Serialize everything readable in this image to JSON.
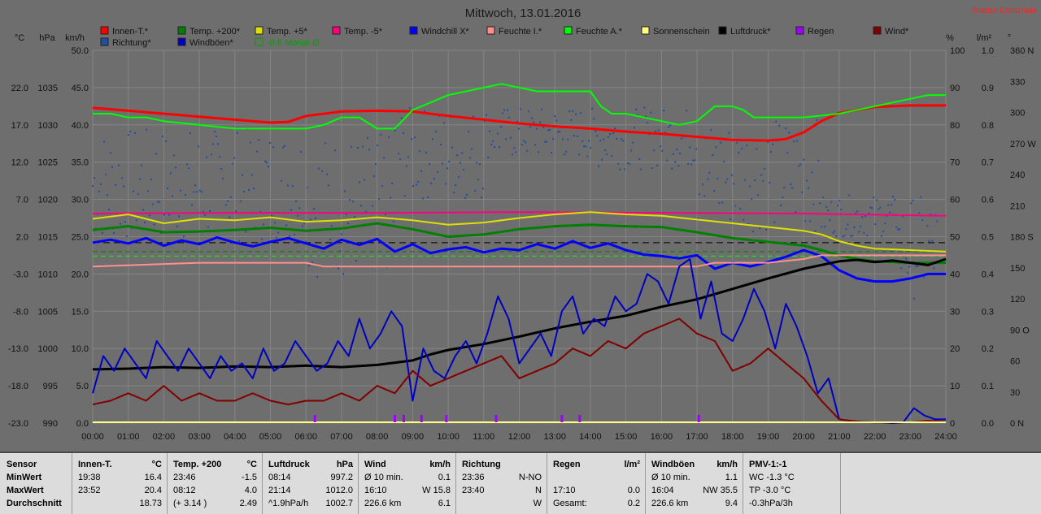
{
  "chart_data": {
    "type": "line",
    "title": "Mittwoch, 13.01.2016",
    "station": "Station Göritzhain",
    "x_ticks": [
      "00:00",
      "01:00",
      "02:00",
      "03:00",
      "04:00",
      "05:00",
      "06:00",
      "07:00",
      "08:00",
      "09:00",
      "10:00",
      "11:00",
      "12:00",
      "13:00",
      "14:00",
      "15:00",
      "16:00",
      "17:00",
      "18:00",
      "19:00",
      "20:00",
      "21:00",
      "22:00",
      "23:00",
      "24:00"
    ],
    "axes": {
      "temp": {
        "unit": "°C",
        "ticks": [
          "22.0",
          "17.0",
          "12.0",
          "7.0",
          "2.0",
          "-3.0",
          "-8.0",
          "-13.0",
          "-18.0",
          "-23.0"
        ],
        "range": [
          -23,
          27
        ]
      },
      "pressure": {
        "unit": "hPa",
        "ticks": [
          "1035",
          "1030",
          "1025",
          "1020",
          "1015",
          "1010",
          "1005",
          "1000",
          "995",
          "990"
        ],
        "range": [
          990,
          1040
        ]
      },
      "wind": {
        "unit": "km/h",
        "ticks": [
          "50.0",
          "45.0",
          "40.0",
          "35.0",
          "30.0",
          "25.0",
          "20.0",
          "15.0",
          "10.0",
          "5.0",
          "0.0"
        ],
        "range": [
          0,
          50
        ]
      },
      "humidity": {
        "unit": "%",
        "ticks": [
          "100",
          "90",
          "80",
          "70",
          "60",
          "50",
          "40",
          "30",
          "20",
          "10",
          "0"
        ],
        "range": [
          0,
          100
        ]
      },
      "rain": {
        "unit": "l/m²",
        "ticks": [
          "1.0",
          "0.9",
          "0.8",
          "0.7",
          "0.6",
          "0.5",
          "0.4",
          "0.3",
          "0.2",
          "0.1",
          "0.0"
        ],
        "range": [
          0,
          1
        ]
      },
      "direction": {
        "unit": "°",
        "ticks": [
          "360 N",
          "330",
          "300",
          "270 W",
          "240",
          "210",
          "180 S",
          "150",
          "120",
          "90 O",
          "60",
          "30",
          "0 N"
        ],
        "range": [
          0,
          360
        ]
      }
    },
    "legend": [
      {
        "name": "Innen-T.*",
        "color": "#ff0000"
      },
      {
        "name": "Temp. +200*",
        "color": "#008000"
      },
      {
        "name": "Temp. +5*",
        "color": "#e0e000"
      },
      {
        "name": "Temp. -5*",
        "color": "#ff0080"
      },
      {
        "name": "Windchill X*",
        "color": "#0000ff"
      },
      {
        "name": "Feuchte I.*",
        "color": "#ff9090"
      },
      {
        "name": "Feuchte A.*",
        "color": "#00ff00"
      },
      {
        "name": "Sonnenschein",
        "color": "#ffff80"
      },
      {
        "name": "Luftdruck*",
        "color": "#000000"
      },
      {
        "name": "Regen",
        "color": "#a000ff"
      },
      {
        "name": "Wind*",
        "color": "#800000"
      },
      {
        "name": "Richtung*",
        "color": "#1e4fa0"
      },
      {
        "name": "Windböen*",
        "color": "#0000c0"
      },
      {
        "name": "-0.6 Monat-Ø",
        "color": "#00a000"
      }
    ],
    "series": [
      {
        "name": "Innen-T.*",
        "axis": "temp",
        "color": "#ff0000",
        "width": 3,
        "x": [
          0,
          1,
          2,
          3,
          4,
          5,
          5.5,
          6,
          7,
          8,
          9,
          10,
          11,
          12,
          13,
          14,
          15,
          16,
          17,
          18,
          19,
          19.5,
          20,
          20.5,
          21,
          22,
          23,
          24
        ],
        "y": [
          19.3,
          18.9,
          18.5,
          18.1,
          17.7,
          17.3,
          17.4,
          18.2,
          18.8,
          18.9,
          18.8,
          18.2,
          17.7,
          17.2,
          16.8,
          16.5,
          16.1,
          15.8,
          15.4,
          15.0,
          14.9,
          15.1,
          16.0,
          17.5,
          18.6,
          19.4,
          19.6,
          19.6
        ]
      },
      {
        "name": "Feuchte A.*",
        "axis": "humidity",
        "color": "#00ff00",
        "width": 2,
        "x": [
          0,
          0.5,
          1,
          1.5,
          2,
          3,
          4,
          5,
          6,
          6.5,
          7,
          7.5,
          8,
          8.5,
          9,
          9.5,
          10,
          11,
          11.5,
          12,
          12.5,
          13,
          14,
          14.3,
          14.6,
          15,
          16,
          16.5,
          17,
          17.5,
          18,
          18.3,
          18.6,
          19,
          20,
          21,
          22,
          23,
          23.5,
          24
        ],
        "y": [
          83,
          83,
          82,
          82,
          81,
          80,
          79,
          79,
          79,
          80,
          82,
          82,
          79,
          79,
          84,
          86,
          88,
          90,
          91,
          90,
          89,
          89,
          89,
          85,
          83,
          83,
          81,
          80,
          81,
          85,
          85,
          84,
          82,
          82,
          82,
          83,
          85,
          87,
          88,
          88
        ]
      },
      {
        "name": "Temp. -5*",
        "axis": "temp",
        "color": "#ff0080",
        "width": 2,
        "x": [
          0,
          4,
          8,
          12,
          16,
          20,
          24
        ],
        "y": [
          5.1,
          5.2,
          5.2,
          5.3,
          5.2,
          5.1,
          4.8
        ]
      },
      {
        "name": "Temp. +5*",
        "axis": "temp",
        "color": "#e0e000",
        "width": 2,
        "x": [
          0,
          1,
          2,
          3,
          4,
          5,
          6,
          7,
          8,
          9,
          10,
          11,
          12,
          13,
          14,
          15,
          16,
          17,
          18,
          19,
          20,
          20.5,
          21,
          21.5,
          22,
          23,
          24
        ],
        "y": [
          4.4,
          5.0,
          3.8,
          4.4,
          4.2,
          4.6,
          4.0,
          4.2,
          4.6,
          4.2,
          3.6,
          3.9,
          4.5,
          5.0,
          5.3,
          5.0,
          4.8,
          4.3,
          3.8,
          3.3,
          2.8,
          2.3,
          1.4,
          0.8,
          0.4,
          0.2,
          0.0
        ]
      },
      {
        "name": "Temp. +200*",
        "axis": "temp",
        "color": "#008000",
        "width": 3,
        "x": [
          0,
          1,
          2,
          3,
          4,
          5,
          6,
          7,
          8,
          9,
          10,
          11,
          12,
          13,
          14,
          15,
          16,
          17,
          18,
          19,
          20,
          20.5,
          21,
          21.5,
          22,
          23,
          24
        ],
        "y": [
          2.9,
          3.4,
          2.6,
          2.7,
          2.9,
          3.2,
          2.8,
          3.1,
          3.8,
          3.0,
          2.0,
          2.3,
          3.0,
          3.4,
          3.6,
          3.4,
          3.3,
          2.6,
          1.8,
          1.3,
          0.8,
          0.2,
          -0.5,
          -1.0,
          -1.3,
          -1.5,
          -1.5
        ]
      },
      {
        "name": "Windchill X*",
        "axis": "temp",
        "color": "#0000ff",
        "width": 3,
        "x": [
          0,
          0.5,
          1,
          1.5,
          2,
          2.5,
          3,
          3.5,
          4,
          4.5,
          5,
          5.5,
          6,
          6.5,
          7,
          7.5,
          8,
          8.5,
          9,
          9.5,
          10,
          10.5,
          11,
          11.5,
          12,
          12.5,
          13,
          13.5,
          14,
          14.5,
          15,
          15.5,
          16,
          16.5,
          17,
          17.5,
          18,
          18.5,
          19,
          19.5,
          20,
          20.5,
          21,
          21.5,
          22,
          22.5,
          23,
          23.5,
          24
        ],
        "y": [
          1.2,
          1.6,
          1.1,
          1.8,
          0.8,
          1.5,
          1.0,
          1.9,
          1.2,
          0.7,
          1.3,
          1.8,
          1.1,
          0.4,
          1.6,
          0.9,
          1.7,
          0.0,
          1.0,
          -0.2,
          0.3,
          0.6,
          -0.1,
          0.4,
          0.2,
          1.0,
          0.4,
          1.4,
          0.5,
          1.1,
          0.2,
          -0.4,
          -0.6,
          -0.9,
          -0.5,
          -2.3,
          -1.5,
          -2.0,
          -1.4,
          -0.7,
          0.2,
          -0.6,
          -2.5,
          -3.6,
          -4.0,
          -4.0,
          -3.6,
          -3.0,
          -3.0
        ]
      },
      {
        "name": "Feuchte I.*",
        "axis": "humidity",
        "color": "#ff9090",
        "width": 2,
        "x": [
          0,
          3,
          6,
          6.5,
          7,
          8,
          10,
          12,
          13.2,
          14,
          16,
          17,
          17.5,
          18,
          19,
          20,
          20.5,
          21,
          22,
          23,
          24
        ],
        "y": [
          42,
          43,
          43,
          42,
          42,
          42,
          42,
          42,
          42,
          42,
          42,
          42,
          43,
          43,
          43,
          44,
          45,
          45,
          45,
          45,
          45
        ]
      },
      {
        "name": "Luftdruck*",
        "axis": "pressure",
        "color": "#000000",
        "width": 3,
        "x": [
          0,
          1,
          2,
          3,
          4,
          5,
          6,
          7,
          8,
          9,
          9.5,
          10,
          11,
          12,
          13,
          14,
          15,
          16,
          17,
          18,
          19,
          20,
          20.5,
          21,
          21.5,
          22,
          22.5,
          23,
          23.5,
          24
        ],
        "y": [
          997.2,
          997.3,
          997.5,
          997.4,
          997.6,
          997.5,
          997.7,
          997.5,
          997.8,
          998.4,
          999.2,
          999.8,
          1000.6,
          1001.6,
          1002.7,
          1003.6,
          1004.4,
          1005.6,
          1006.6,
          1008.0,
          1009.4,
          1010.7,
          1011.2,
          1011.7,
          1011.9,
          1011.6,
          1011.8,
          1011.5,
          1011.2,
          1012.0
        ]
      },
      {
        "name": "Windböen*",
        "axis": "wind",
        "color": "#0000c0",
        "width": 2,
        "x": [
          0,
          0.3,
          0.6,
          0.9,
          1.2,
          1.5,
          1.8,
          2.1,
          2.4,
          2.7,
          3,
          3.3,
          3.6,
          3.9,
          4.2,
          4.5,
          4.8,
          5.1,
          5.4,
          5.7,
          6,
          6.3,
          6.6,
          6.9,
          7.2,
          7.5,
          7.8,
          8.1,
          8.4,
          8.7,
          9,
          9.3,
          9.6,
          9.9,
          10.2,
          10.5,
          10.8,
          11.1,
          11.4,
          11.7,
          12,
          12.3,
          12.6,
          12.9,
          13.2,
          13.5,
          13.8,
          14.1,
          14.4,
          14.7,
          15,
          15.3,
          15.6,
          15.9,
          16.2,
          16.5,
          16.8,
          17.1,
          17.4,
          17.7,
          18,
          18.3,
          18.6,
          18.9,
          19.2,
          19.5,
          19.8,
          20.1,
          20.4,
          20.7,
          21,
          21.3,
          21.6,
          21.9,
          22.2,
          22.5,
          22.8,
          23.1,
          23.4,
          23.7,
          24
        ],
        "y": [
          4,
          9,
          7,
          10,
          8,
          6,
          11,
          9,
          7,
          10,
          8,
          6,
          9,
          7,
          8,
          6,
          10,
          7,
          8,
          11,
          9,
          7,
          8,
          11,
          9,
          14,
          10,
          12,
          15,
          13,
          3,
          10,
          7,
          6,
          9,
          11,
          8,
          12,
          17,
          14,
          8,
          10,
          12,
          9,
          15,
          17,
          12,
          14,
          13,
          17,
          15,
          16,
          20,
          19,
          16,
          21,
          22,
          14,
          19,
          12,
          11,
          14,
          18,
          15,
          10,
          16,
          13,
          9,
          4,
          6,
          0.5,
          0.3,
          0.2,
          0.1,
          0.1,
          0.0,
          0.1,
          2,
          1,
          0.5,
          0.5
        ]
      },
      {
        "name": "Wind*",
        "axis": "wind",
        "color": "#800000",
        "width": 2,
        "x": [
          0,
          0.5,
          1,
          1.5,
          2,
          2.5,
          3,
          3.5,
          4,
          4.5,
          5,
          5.5,
          6,
          6.5,
          7,
          7.5,
          8,
          8.5,
          9,
          9.5,
          10,
          10.5,
          11,
          11.5,
          12,
          12.5,
          13,
          13.5,
          14,
          14.5,
          15,
          15.5,
          16,
          16.5,
          17,
          17.5,
          18,
          18.5,
          19,
          19.5,
          20,
          20.5,
          21,
          21.5,
          22,
          22.5,
          23,
          23.5,
          24
        ],
        "y": [
          2.5,
          3,
          4,
          3,
          5,
          3,
          4,
          3,
          3,
          4,
          3,
          2.5,
          3,
          3,
          4,
          3,
          5,
          4,
          7,
          5,
          6,
          7,
          8,
          9,
          6,
          7,
          8,
          10,
          9,
          11,
          10,
          12,
          13,
          14,
          12,
          11,
          7,
          8,
          10,
          8,
          6,
          3,
          0.5,
          0.2,
          0.1,
          0.1,
          0.1,
          0.3,
          0.2
        ]
      }
    ],
    "scatter": {
      "name": "Richtung*",
      "axis": "direction",
      "color": "#1e4fa0"
    },
    "rain_marks": {
      "axis": "rain",
      "color": "#a000ff",
      "x": [
        6.25,
        8.5,
        8.75,
        9.25,
        9.95,
        11.35,
        13.2,
        13.7,
        17.05
      ]
    },
    "reference_lines": [
      {
        "axis": "wind",
        "y": 24.2,
        "color": "#000000",
        "dash": "8,5"
      },
      {
        "axis": "wind",
        "y": 23.0,
        "color": "#008000",
        "dash": "6,4"
      },
      {
        "axis": "wind",
        "y": 22.4,
        "color": "#00ff00",
        "dash": "6,4"
      }
    ]
  },
  "stats": {
    "cols": [
      {
        "h1": "Sensor",
        "h2": "",
        "rows": [
          [
            "MinWert",
            "",
            ""
          ],
          [
            "MaxWert",
            "",
            ""
          ],
          [
            "Durchschnitt",
            "",
            ""
          ]
        ]
      },
      {
        "h1": "Innen-T.",
        "h2": "°C",
        "rows": [
          [
            "19:38",
            "",
            "16.4"
          ],
          [
            "23:52",
            "",
            "20.4"
          ],
          [
            "",
            "",
            "18.73"
          ]
        ]
      },
      {
        "h1": "Temp. +200",
        "h2": "°C",
        "rows": [
          [
            "23:46",
            "",
            "-1.5"
          ],
          [
            "08:12",
            "",
            "4.0"
          ],
          [
            "(+ 3.14 )",
            "",
            "2.49"
          ]
        ]
      },
      {
        "h1": "Luftdruck",
        "h2": "hPa",
        "rows": [
          [
            "08:14",
            "",
            "997.2"
          ],
          [
            "21:14",
            "",
            "1012.0"
          ],
          [
            "^1.9hPa/h",
            "",
            "1002.7"
          ]
        ]
      },
      {
        "h1": "Wind",
        "h2": "km/h",
        "rows": [
          [
            "Ø 10 min.",
            "",
            "0.1"
          ],
          [
            "16:10",
            "",
            "W 15.8"
          ],
          [
            "226.6 km",
            "",
            "6.1"
          ]
        ]
      },
      {
        "h1": "Richtung",
        "h2": "",
        "rows": [
          [
            "23:36",
            "",
            "N-NO"
          ],
          [
            "23:40",
            "",
            "N"
          ],
          [
            "",
            "",
            "W"
          ]
        ]
      },
      {
        "h1": "Regen",
        "h2": "l/m²",
        "rows": [
          [
            "",
            "",
            ""
          ],
          [
            "17:10",
            "",
            "0.0"
          ],
          [
            "Gesamt:",
            "",
            "0.2"
          ]
        ]
      },
      {
        "h1": "Windböen",
        "h2": "km/h",
        "rows": [
          [
            "Ø 10 min.",
            "",
            "1.1"
          ],
          [
            "16:04",
            "",
            "NW 35.5"
          ],
          [
            "226.6 km",
            "",
            "9.4"
          ]
        ]
      },
      {
        "h1": "PMV-1:-1",
        "h2": "",
        "rows": [
          [
            "WC -1.3 °C",
            "",
            ""
          ],
          [
            "TP -3.0 °C",
            "",
            ""
          ],
          [
            "-0.3hPa/3h",
            "",
            ""
          ]
        ]
      }
    ]
  }
}
